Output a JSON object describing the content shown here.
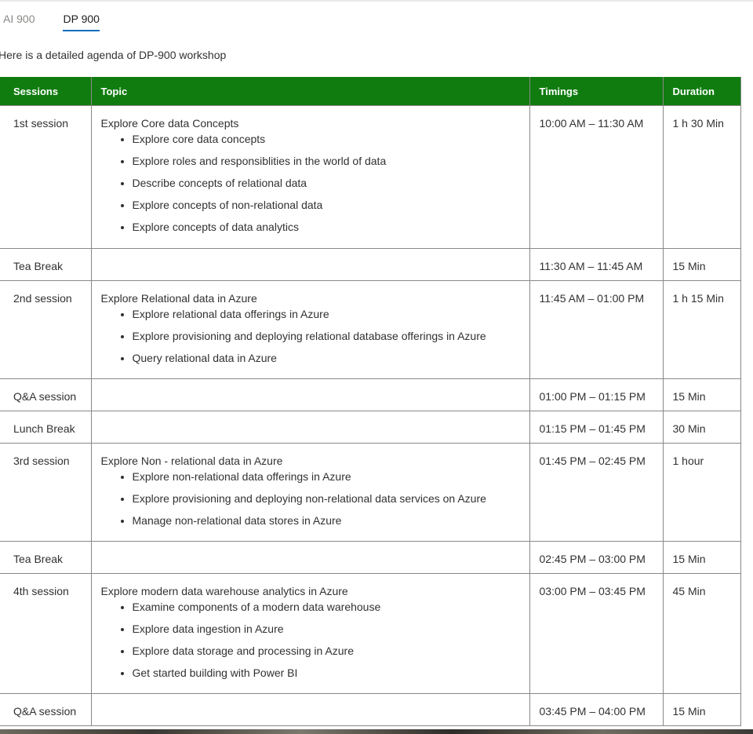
{
  "tabs": [
    {
      "label": "AI 900",
      "active": false
    },
    {
      "label": "DP 900",
      "active": true
    }
  ],
  "intro_text": "Here is a detailed agenda of DP-900 workshop",
  "table": {
    "headers": [
      "Sessions",
      "Topic",
      "Timings",
      "Duration"
    ],
    "rows": [
      {
        "session": "1st session",
        "topic": "Explore Core data Concepts",
        "subtopics": [
          "Explore core data concepts",
          "Explore roles and responsiblities in the world of data",
          "Describe concepts of relational data",
          "Explore concepts of non-relational data",
          "Explore concepts of data analytics"
        ],
        "timing": "10:00 AM – 11:30 AM",
        "duration": "1 h 30 Min"
      },
      {
        "session": "Tea Break",
        "topic": "",
        "subtopics": [],
        "timing": "11:30 AM – 11:45 AM",
        "duration": "15 Min"
      },
      {
        "session": "2nd session",
        "topic": "Explore Relational data in Azure",
        "subtopics": [
          "Explore relational data offerings in Azure",
          "Explore provisioning and deploying relational database offerings in Azure",
          "Query relational data in Azure"
        ],
        "timing": "11:45 AM – 01:00 PM",
        "duration": "1 h 15 Min"
      },
      {
        "session": "Q&A session",
        "topic": "",
        "subtopics": [],
        "timing": "01:00 PM – 01:15 PM",
        "duration": "15 Min"
      },
      {
        "session": "Lunch Break",
        "topic": "",
        "subtopics": [],
        "timing": "01:15 PM – 01:45 PM",
        "duration": "30 Min"
      },
      {
        "session": "3rd session",
        "topic": "Explore Non - relational data in Azure",
        "subtopics": [
          "Explore non-relational data offerings in Azure",
          "Explore provisioning and deploying non-relational data services on Azure",
          "Manage non-relational data stores in Azure"
        ],
        "timing": "01:45 PM – 02:45 PM",
        "duration": "1 hour"
      },
      {
        "session": "Tea Break",
        "topic": "",
        "subtopics": [],
        "timing": "02:45 PM – 03:00 PM",
        "duration": "15 Min"
      },
      {
        "session": "4th session",
        "topic": "Explore modern data warehouse analytics in Azure",
        "subtopics": [
          "Examine components of a modern data warehouse",
          "Explore data ingestion in Azure",
          "Explore data storage and processing in Azure",
          "Get started building with Power BI"
        ],
        "timing": "03:00 PM – 03:45 PM",
        "duration": "45 Min"
      },
      {
        "session": "Q&A session",
        "topic": "",
        "subtopics": [],
        "timing": "03:45 PM – 04:00 PM",
        "duration": "15 Min"
      }
    ]
  },
  "colors": {
    "header_bg": "#107c10",
    "header_text": "#ffffff",
    "tab_underline": "#0f6cbd",
    "border": "#8a8886"
  }
}
